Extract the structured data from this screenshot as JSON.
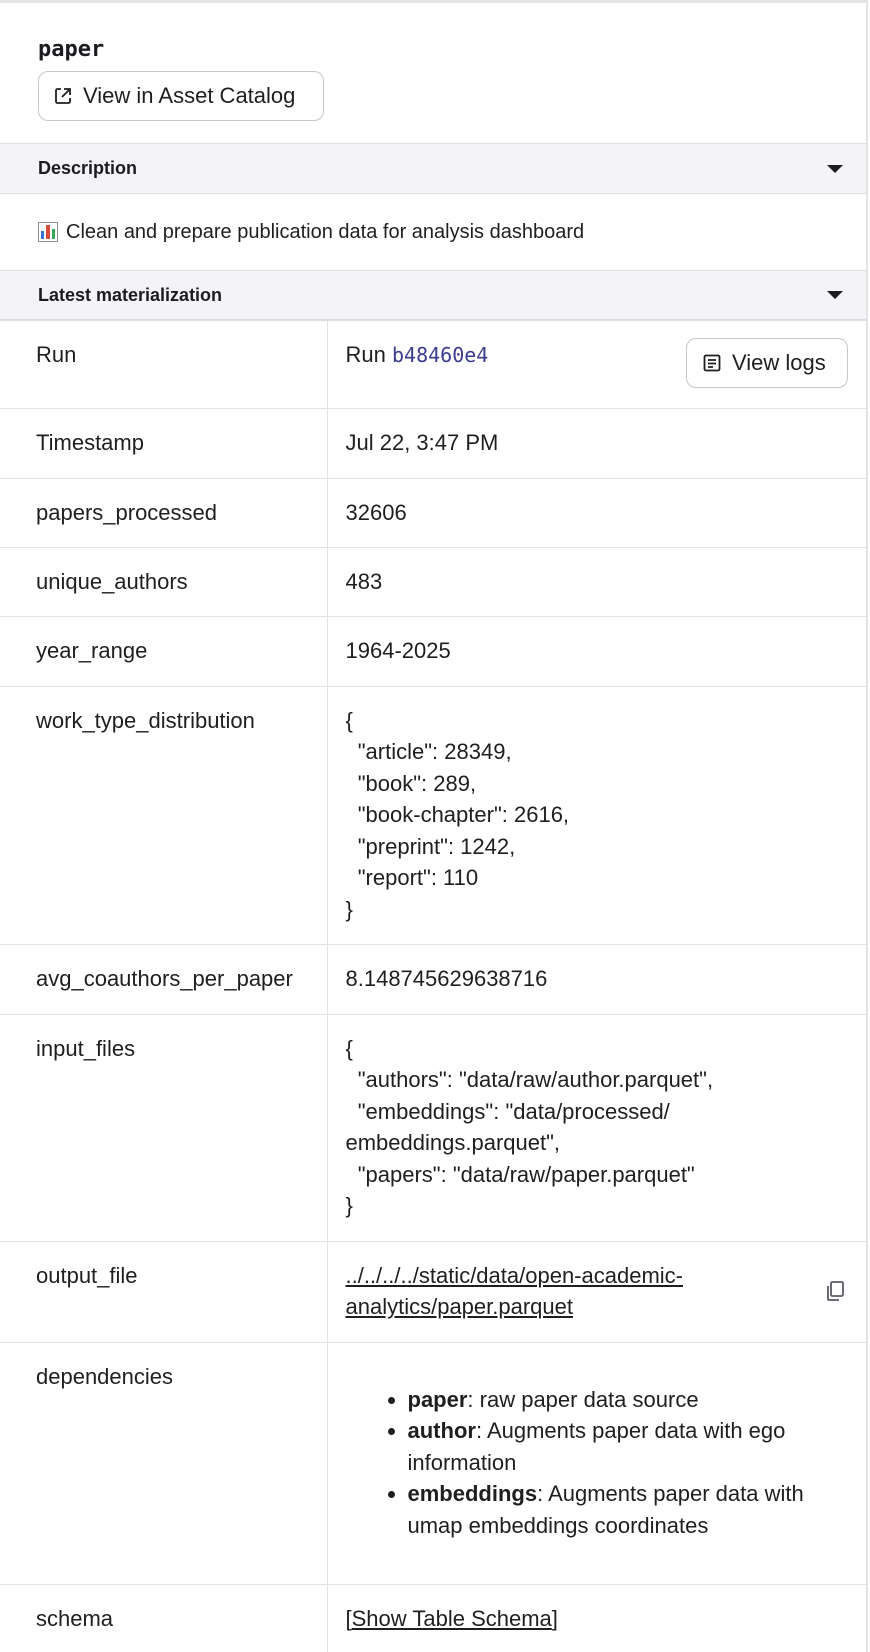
{
  "asset": {
    "title": "paper",
    "catalog_button": "View in Asset Catalog"
  },
  "description_section": {
    "label": "Description",
    "text": "Clean and prepare publication data for analysis dashboard",
    "icon": "bar-chart-emoji"
  },
  "materialization_section": {
    "label": "Latest materialization"
  },
  "rows": {
    "run": {
      "key": "Run",
      "prefix": "Run",
      "run_id": "b48460e4",
      "logs_button": "View logs"
    },
    "timestamp": {
      "key": "Timestamp",
      "value": "Jul 22, 3:47 PM"
    },
    "papers_processed": {
      "key": "papers_processed",
      "value": "32606"
    },
    "unique_authors": {
      "key": "unique_authors",
      "value": "483"
    },
    "year_range": {
      "key": "year_range",
      "value": "1964-2025"
    },
    "work_type_distribution": {
      "key": "work_type_distribution",
      "value": "{\n  \"article\": 28349,\n  \"book\": 289,\n  \"book-chapter\": 2616,\n  \"preprint\": 1242,\n  \"report\": 110\n}"
    },
    "avg_coauthors_per_paper": {
      "key": "avg_coauthors_per_paper",
      "value": "8.148745629638716"
    },
    "input_files": {
      "key": "input_files",
      "value": "{\n  \"authors\": \"data/raw/author.parquet\",\n  \"embeddings\": \"data/processed/\nembeddings.parquet\",\n  \"papers\": \"data/raw/paper.parquet\"\n}"
    },
    "output_file": {
      "key": "output_file",
      "value_line1": "../../../../static/data/open-academic-",
      "value_line2": "analytics/paper.parquet"
    },
    "dependencies": {
      "key": "dependencies",
      "items": [
        {
          "name": "paper",
          "desc": ": raw paper data source"
        },
        {
          "name": "author",
          "desc": ": Augments paper data with ego information"
        },
        {
          "name": "embeddings",
          "desc": ": Augments paper data with umap embeddings coordinates"
        }
      ]
    },
    "schema": {
      "key": "schema",
      "bracket_open": "[",
      "link": "Show Table Schema",
      "bracket_close": "]"
    }
  },
  "colors": {
    "run_id": "#3b3b8f",
    "section_bg": "#f4f4f6",
    "border": "#e2e2e6"
  }
}
